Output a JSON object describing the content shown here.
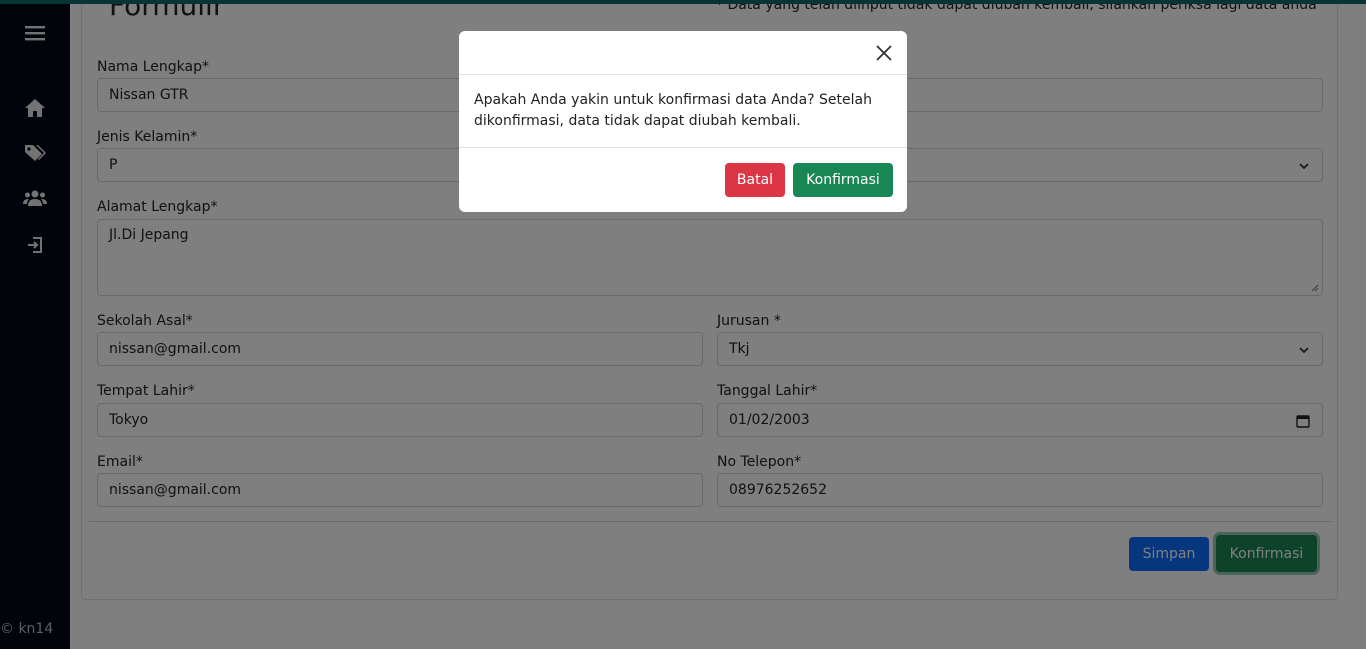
{
  "sidebar": {
    "menu_icon": "hamburger-icon",
    "items": [
      {
        "icon": "home-icon"
      },
      {
        "icon": "tags-icon"
      },
      {
        "icon": "users-icon"
      },
      {
        "icon": "logout-icon"
      }
    ],
    "copyright": "© kn14"
  },
  "page": {
    "title": "Formulir",
    "note": "* Data yang telah diinput tidak dapat diubah kembali, silahkan periksa lagi data anda"
  },
  "form": {
    "nama": {
      "label": "Nama Lengkap*",
      "value": "Nissan GTR"
    },
    "jenis_kelamin": {
      "label": "Jenis Kelamin*",
      "value": "P"
    },
    "alamat": {
      "label": "Alamat Lengkap*",
      "value": "Jl.Di Jepang"
    },
    "sekolah": {
      "label": "Sekolah Asal*",
      "value": "nissan@gmail.com"
    },
    "jurusan": {
      "label": "Jurusan *",
      "value": "Tkj"
    },
    "tempat_lahir": {
      "label": "Tempat Lahir*",
      "value": "Tokyo"
    },
    "tanggal_lahir": {
      "label": "Tanggal Lahir*",
      "value": "01/02/2003"
    },
    "email": {
      "label": "Email*",
      "value": "nissan@gmail.com"
    },
    "telepon": {
      "label": "No Telepon*",
      "value": "08976252652"
    }
  },
  "actions": {
    "save_label": "Simpan",
    "confirm_label": "Konfirmasi"
  },
  "modal": {
    "body": "Apakah Anda yakin untuk konfirmasi data Anda? Setelah dikonfirmasi, data tidak dapat diubah kembali.",
    "cancel_label": "Batal",
    "confirm_label": "Konfirmasi"
  },
  "colors": {
    "primary": "#0d6efd",
    "success": "#198754",
    "danger": "#dc3545",
    "sidebar": "#050816"
  }
}
